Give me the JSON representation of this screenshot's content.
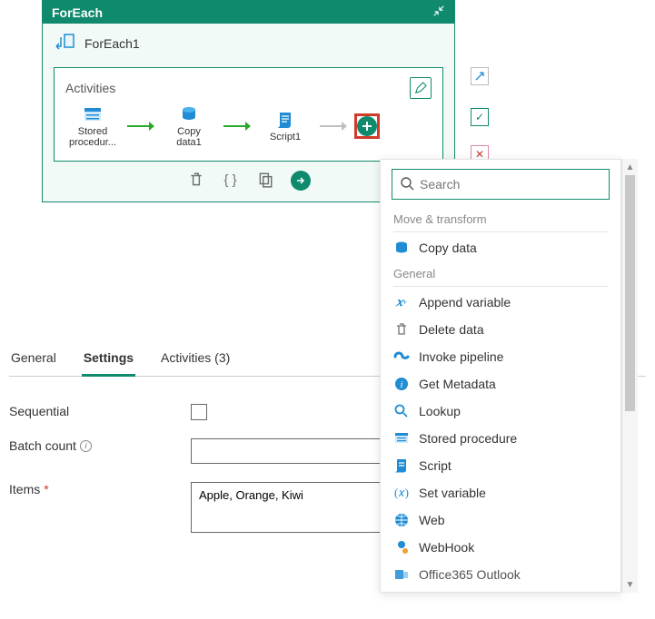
{
  "header": {
    "title": "ForEach"
  },
  "foreach": {
    "name": "ForEach1",
    "activities_label": "Activities",
    "items": [
      {
        "label": "Stored\nprocedur..."
      },
      {
        "label": "Copy\ndata1"
      },
      {
        "label": "Script1"
      }
    ]
  },
  "popup": {
    "search_placeholder": "Search",
    "section1": "Move & transform",
    "copy_data": "Copy data",
    "section2": "General",
    "append_variable": "Append variable",
    "delete_data": "Delete data",
    "invoke_pipeline": "Invoke pipeline",
    "get_metadata": "Get Metadata",
    "lookup": "Lookup",
    "stored_procedure": "Stored procedure",
    "script": "Script",
    "set_variable": "Set variable",
    "web": "Web",
    "webhook": "WebHook",
    "office365": "Office365 Outlook"
  },
  "tabs": {
    "general": "General",
    "settings": "Settings",
    "activities": "Activities (3)"
  },
  "settings": {
    "sequential_label": "Sequential",
    "batch_label": "Batch count",
    "items_label": "Items",
    "items_value": "Apple, Orange, Kiwi"
  }
}
